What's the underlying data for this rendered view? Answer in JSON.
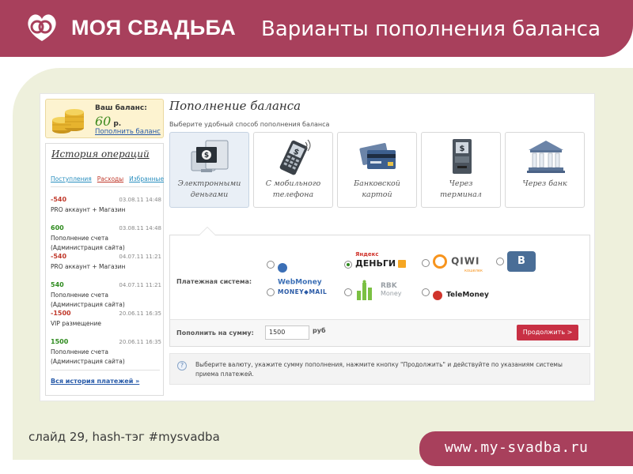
{
  "header": {
    "brand": "МОЯ СВАДЬБА",
    "slide_title": "Варианты пополнения баланса"
  },
  "balance": {
    "label": "Ваш баланс:",
    "value": "60",
    "unit": "р.",
    "link": "Пополнить баланс"
  },
  "history": {
    "title": "История операций",
    "tabs": [
      "Поступления",
      "Расходы",
      "Избранные"
    ],
    "entries": [
      {
        "amount": "-540",
        "type": "negative",
        "date": "03.08.11 14:48",
        "desc": "PRO аккаунт + Магазин"
      },
      {
        "amount": "600",
        "type": "positive",
        "date": "03.08.11 14:48",
        "desc": "Пополнение счета (Администрация сайта)"
      },
      {
        "amount": "-540",
        "type": "negative",
        "date": "04.07.11 11:21",
        "desc": "PRO аккаунт + Магазин"
      },
      {
        "amount": "540",
        "type": "positive",
        "date": "04.07.11 11:21",
        "desc": "Пополнение счета (Администрация сайта)"
      },
      {
        "amount": "-1500",
        "type": "negative",
        "date": "20.06.11 16:35",
        "desc": "VIP размещение"
      },
      {
        "amount": "1500",
        "type": "positive",
        "date": "20.06.11 16:35",
        "desc": "Пополнение счета (Администрация сайта)"
      }
    ],
    "all_link": "Вся история платежей »"
  },
  "topup": {
    "title": "Пополнение баланса",
    "subtitle": "Выберите удобный способ пополнения баланса",
    "methods": [
      {
        "line1": "Электронными",
        "line2": "деньгами",
        "icon": "monitor-money-icon",
        "selected": true
      },
      {
        "line1": "С мобильного",
        "line2": "телефона",
        "icon": "mobile-phone-icon",
        "selected": false
      },
      {
        "line1": "Банковской",
        "line2": "картой",
        "icon": "bank-card-icon",
        "selected": false
      },
      {
        "line1": "Через",
        "line2": "терминал",
        "icon": "payment-terminal-icon",
        "selected": false
      },
      {
        "line1": "Через банк",
        "line2": "",
        "icon": "bank-building-icon",
        "selected": false
      }
    ],
    "payment_system_label": "Платежная система:",
    "payment_systems": {
      "webmoney": "WebMoney",
      "yandex_line1": "Яндекс",
      "yandex_line2": "ДЕНЬГИ",
      "qiwi": "QIWI",
      "qiwi_sub": "кошелек",
      "vk": "В",
      "moneymail": "MONEY◆MAIL",
      "rbk_line1": "RBK",
      "rbk_line2": "Money",
      "telemoney": "TeleMoney",
      "selected": "yandex"
    },
    "amount_label": "Пополнить на сумму:",
    "amount_value": "1500",
    "amount_unit": "руб",
    "continue_button": "Продолжить >",
    "hint_icon": "?",
    "hint": "Выберите валюту, укажите сумму пополнения, нажмите кнопку \"Продолжить\" и действуйте по указаниям системы приема платежей."
  },
  "footer": {
    "caption": "слайд 29, hash-тэг #mysvadba",
    "url": "www.my-svadba.ru"
  },
  "colors": {
    "brand": "#a8405c",
    "panel": "#eef0dc",
    "button": "#c83044",
    "link": "#2659a8",
    "positive": "#2e8b1e",
    "negative": "#c0392b"
  }
}
